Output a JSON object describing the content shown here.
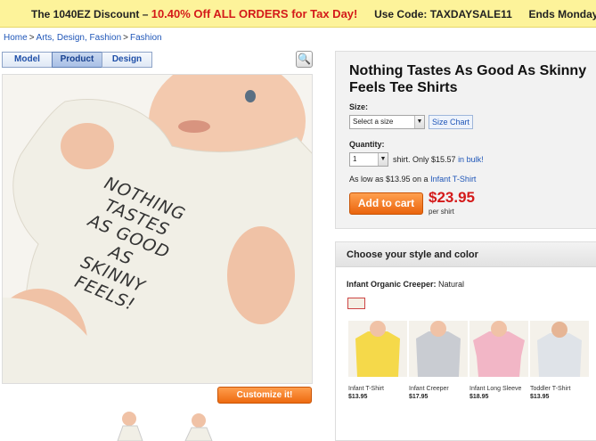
{
  "promo": {
    "lead": "The 1040EZ Discount –",
    "offer": "10.40% Off ALL ORDERS for Tax Day!",
    "code": "Use Code: TAXDAYSALE11",
    "ends": "Ends Monday"
  },
  "breadcrumb": [
    "Home",
    "Arts, Design, Fashion",
    "Fashion"
  ],
  "breadcrumb_sep": ">",
  "view_tabs": [
    {
      "label": "Model",
      "active": false
    },
    {
      "label": "Product",
      "active": true
    },
    {
      "label": "Design",
      "active": false
    }
  ],
  "shirt_print": [
    "NOTHING",
    "TASTES",
    "AS GOOD",
    "AS",
    "SKINNY",
    "FEELS!"
  ],
  "customize_label": "Customize it!",
  "product": {
    "title": "Nothing Tastes As Good As Skinny Feels Tee Shirts",
    "size_label": "Size:",
    "size_value": "Select a size",
    "size_chart": "Size Chart",
    "quantity_label": "Quantity:",
    "quantity_value": "1",
    "bulk_text": "shirt. Only $15.57",
    "bulk_link": "in bulk!",
    "as_low_text": "As low as $13.95 on a",
    "as_low_link": "Infant T-Shirt",
    "add_to_cart": "Add to cart",
    "price": "$23.95",
    "per": "per shirt"
  },
  "style_picker": {
    "heading": "Choose your style and color",
    "selected_style": "Infant Organic Creeper:",
    "selected_color": "Natural",
    "styles": [
      {
        "name": "Infant T-Shirt",
        "price": "$13.95",
        "color": "#f5d94a"
      },
      {
        "name": "Infant Creeper",
        "price": "$17.95",
        "color": "#c9ccd2"
      },
      {
        "name": "Infant Long Sleeve",
        "price": "$18.95",
        "color": "#f2b6c6"
      },
      {
        "name": "Toddler T-Shirt",
        "price": "$13.95",
        "color": "#dfe3e8"
      }
    ]
  },
  "colors": {
    "accent_orange": "#ea640d",
    "price_red": "#d41a1a",
    "link_blue": "#1f56b8",
    "promo_yellow": "#fdf39a"
  }
}
